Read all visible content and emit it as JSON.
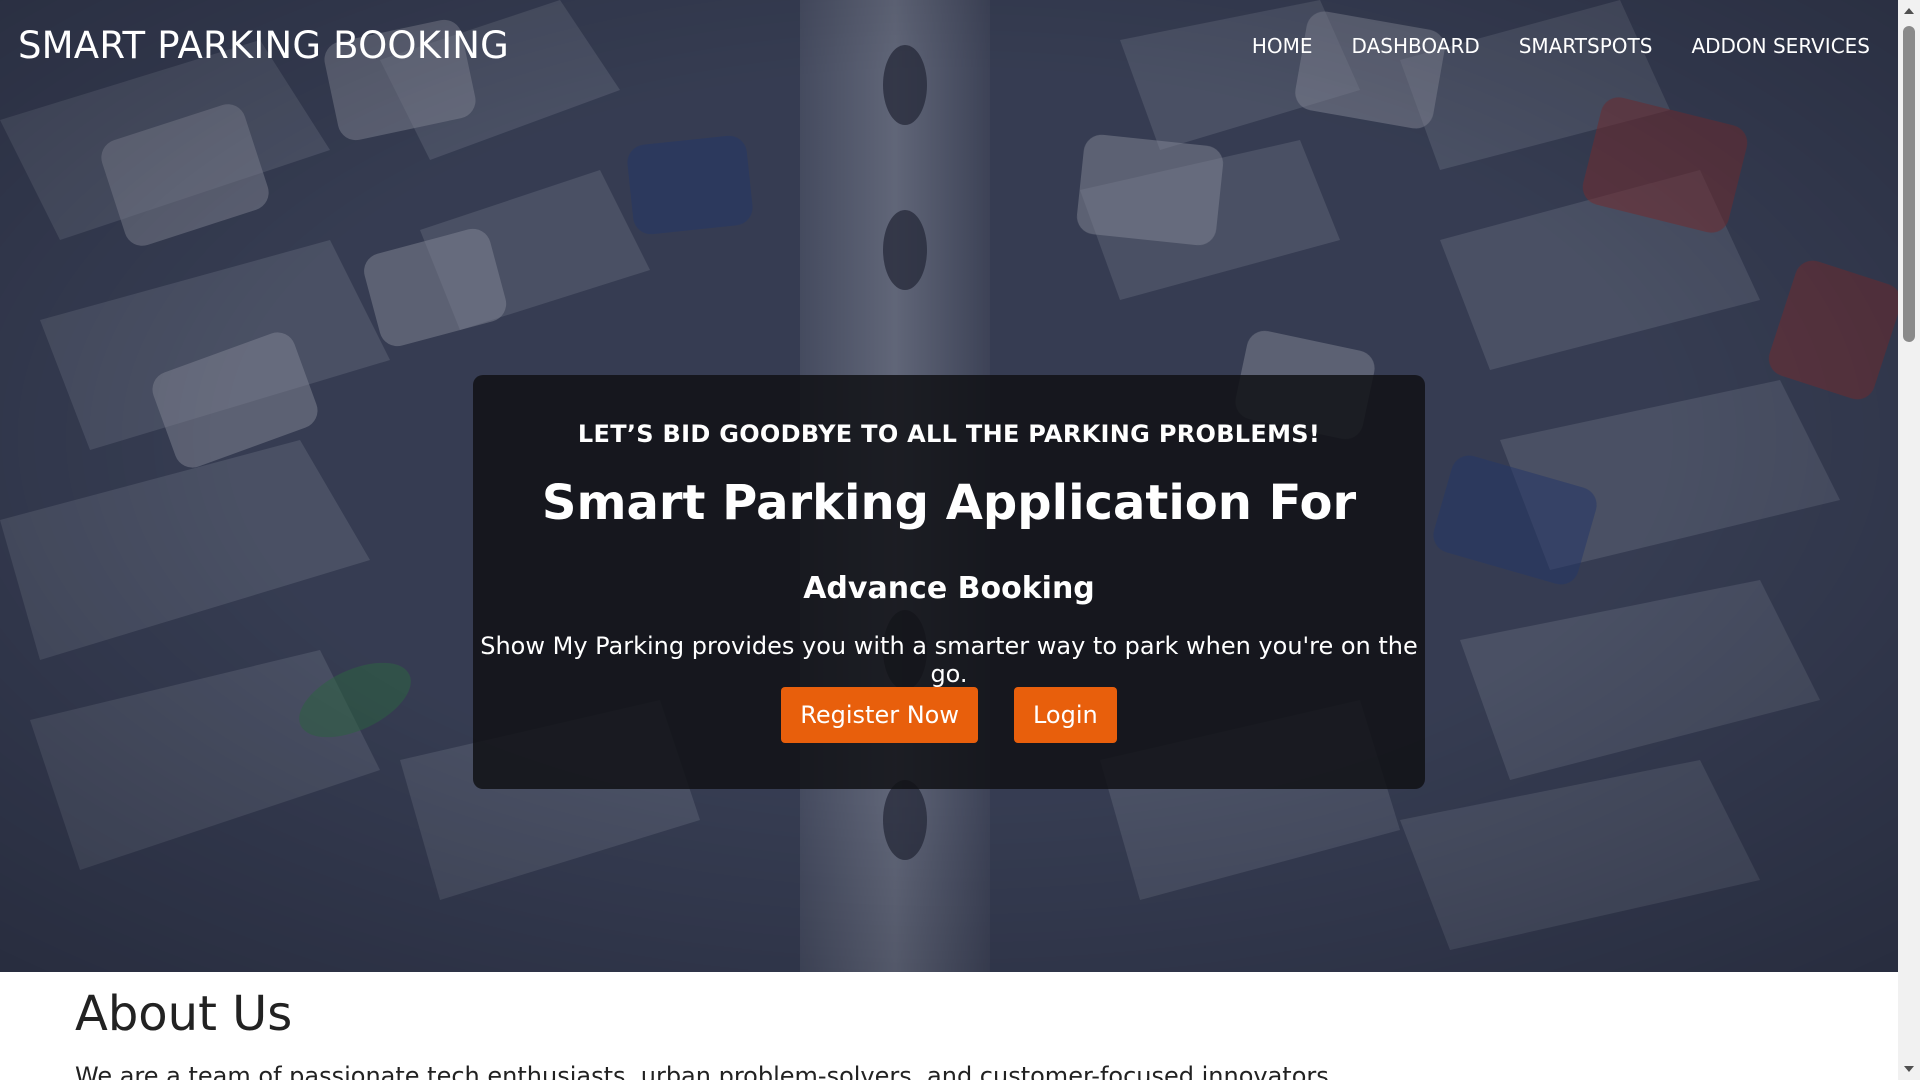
{
  "navbar": {
    "brand": "SMART PARKING BOOKING",
    "links": [
      {
        "label": "HOME"
      },
      {
        "label": "DASHBOARD"
      },
      {
        "label": "SMARTSPOTS"
      },
      {
        "label": "ADDON SERVICES"
      }
    ]
  },
  "hero": {
    "tagline": "LET’S BID GOODBYE TO ALL THE PARKING PROBLEMS!",
    "headline": "Smart Parking Application For",
    "subheadline": "Advance Booking",
    "description": "Show My Parking provides you with a smarter way to park when you're on the go.",
    "register_label": "Register Now",
    "login_label": "Login"
  },
  "about": {
    "title": "About Us",
    "text": "We are a team of passionate tech enthusiasts, urban problem-solvers, and customer-focused innovators."
  },
  "colors": {
    "accent": "#e85f0c",
    "card_bg": "#121216",
    "overlay": "#1c223a"
  },
  "icons": {
    "scroll_up": "chevron-up-icon",
    "scroll_down": "chevron-down-icon"
  }
}
